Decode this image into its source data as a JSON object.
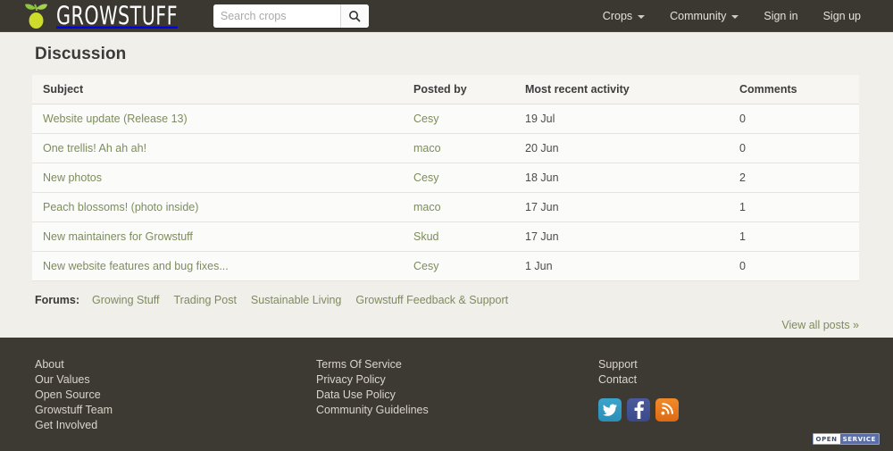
{
  "header": {
    "brand_text": "GROWSTUFF",
    "logo_icon": "pear-leaf-logo",
    "search": {
      "placeholder": "Search crops",
      "value": "",
      "button_icon": "search-icon"
    },
    "nav": [
      {
        "label": "Crops",
        "has_caret": true
      },
      {
        "label": "Community",
        "has_caret": true
      },
      {
        "label": "Sign in",
        "has_caret": false
      },
      {
        "label": "Sign up",
        "has_caret": false
      }
    ]
  },
  "main": {
    "title": "Discussion",
    "table": {
      "columns": [
        "Subject",
        "Posted by",
        "Most recent activity",
        "Comments"
      ],
      "rows": [
        {
          "subject": "Website update (Release 13)",
          "poster": "Cesy",
          "recent": "19 Jul",
          "comments": "0"
        },
        {
          "subject": "One trellis! Ah ah ah!",
          "poster": "maco",
          "recent": "20 Jun",
          "comments": "0"
        },
        {
          "subject": "New photos",
          "poster": "Cesy",
          "recent": "18 Jun",
          "comments": "2"
        },
        {
          "subject": "Peach blossoms! (photo inside)",
          "poster": "maco",
          "recent": "17 Jun",
          "comments": "1"
        },
        {
          "subject": "New maintainers for Growstuff",
          "poster": "Skud",
          "recent": "17 Jun",
          "comments": "1"
        },
        {
          "subject": "New website features and bug fixes...",
          "poster": "Cesy",
          "recent": "1 Jun",
          "comments": "0"
        }
      ]
    },
    "forums": {
      "label": "Forums:",
      "links": [
        "Growing Stuff",
        "Trading Post",
        "Sustainable Living",
        "Growstuff Feedback & Support"
      ]
    },
    "view_all": "View all posts »"
  },
  "footer": {
    "column1": [
      "About",
      "Our Values",
      "Open Source",
      "Growstuff Team",
      "Get Involved"
    ],
    "column2": [
      "Terms Of Service",
      "Privacy Policy",
      "Data Use Policy",
      "Community Guidelines"
    ],
    "column3": [
      "Support",
      "Contact"
    ],
    "social": [
      {
        "name": "twitter-icon",
        "label": "Twitter"
      },
      {
        "name": "facebook-icon",
        "label": "Facebook"
      },
      {
        "name": "blog-rss-icon",
        "label": "Blog"
      }
    ],
    "badge": {
      "part1": "OPEN",
      "part2": "SERVICE"
    }
  },
  "colors": {
    "header_bg": "#3b3832",
    "footer_bg": "#3d3a34",
    "page_bg": "#f1efea",
    "link_green": "#7d8c5c",
    "row_bg": "#fbfbfa"
  }
}
